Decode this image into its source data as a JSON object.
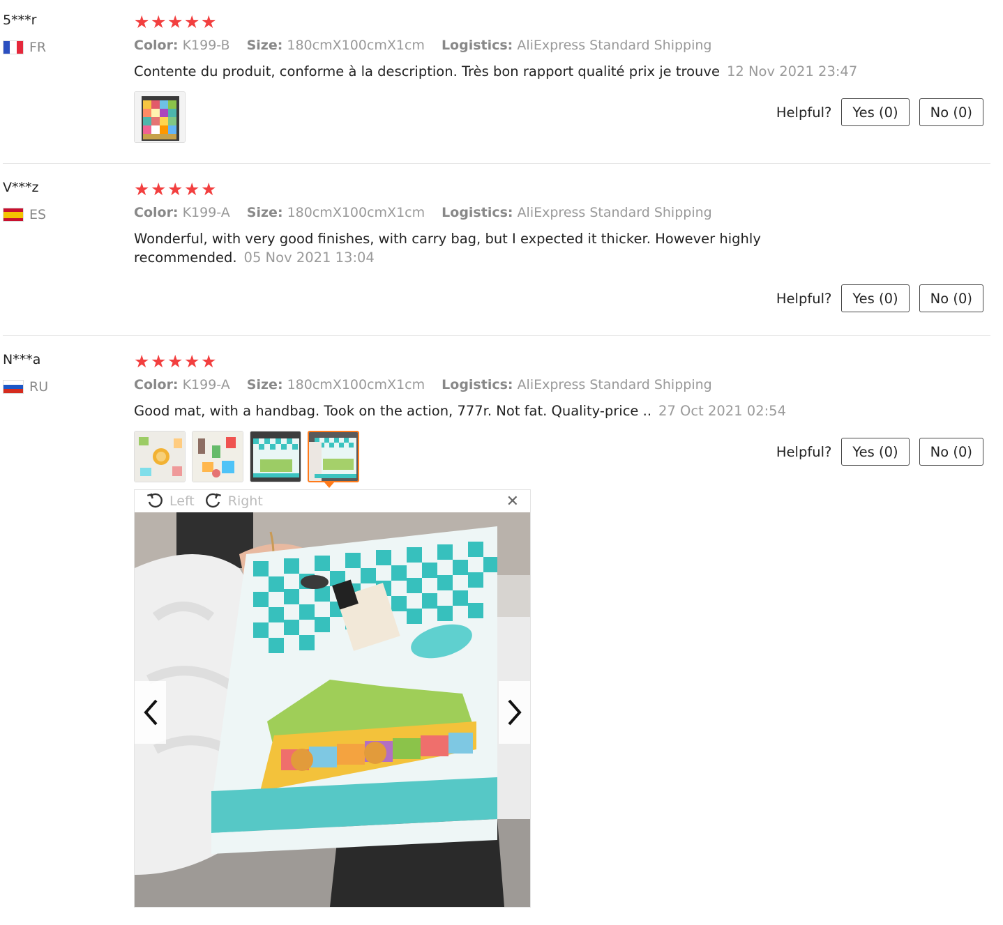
{
  "labels": {
    "color_key": "Color:",
    "size_key": "Size:",
    "logistics_key": "Logistics:",
    "helpful": "Helpful?"
  },
  "colors": {
    "star": "#f23f3f",
    "active_thumb": "#ff7a1a"
  },
  "reviews": [
    {
      "user": "5***r",
      "country": "FR",
      "rating": 5,
      "color": "K199-B",
      "size": "180cmX100cmX1cm",
      "logistics": "AliExpress Standard Shipping",
      "text": "Contente du produit, conforme à la description. Très bon rapport qualité prix je trouve",
      "date": "12 Nov 2021 23:47",
      "yes": "Yes (0)",
      "no": "No (0)"
    },
    {
      "user": "V***z",
      "country": "ES",
      "rating": 5,
      "color": "K199-A",
      "size": "180cmX100cmX1cm",
      "logistics": "AliExpress Standard Shipping",
      "text": "Wonderful, with very good finishes, with carry bag, but I expected it thicker. However highly recommended.",
      "date": "05 Nov 2021 13:04",
      "yes": "Yes (0)",
      "no": "No (0)"
    },
    {
      "user": "N***a",
      "country": "RU",
      "rating": 5,
      "color": "K199-A",
      "size": "180cmX100cmX1cm",
      "logistics": "AliExpress Standard Shipping",
      "text": "Good mat, with a handbag. Took on the action, 777r. Not fat. Quality-price ..",
      "date": "27 Oct 2021 02:54",
      "yes": "Yes (0)",
      "no": "No (0)"
    }
  ],
  "viewer": {
    "rotate_left": "Left",
    "rotate_right": "Right",
    "close_icon": "close-icon",
    "prev_icon": "chevron-left-icon",
    "next_icon": "chevron-right-icon"
  }
}
